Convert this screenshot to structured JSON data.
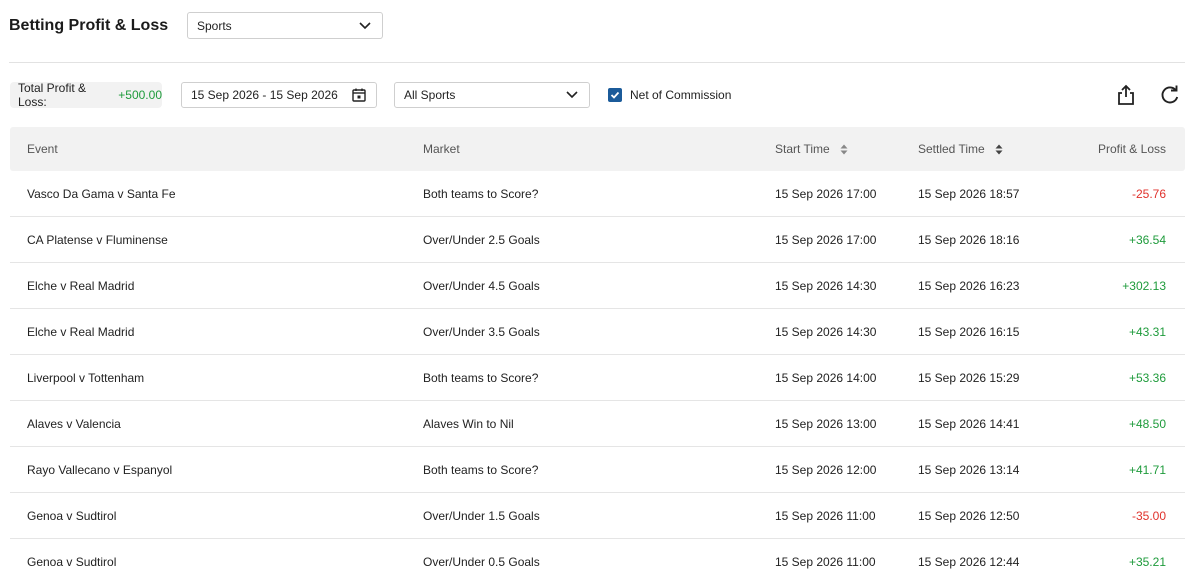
{
  "header": {
    "title": "Betting Profit & Loss",
    "product_select": "Sports"
  },
  "filters": {
    "total_label": "Total Profit & Loss:",
    "total_value": "+500.00",
    "date_range": "15 Sep 2026 - 15 Sep 2026",
    "sport_select": "All Sports",
    "net_of_commission_label": "Net of Commission",
    "net_of_commission_checked": true
  },
  "icons": {
    "calendar": "calendar-icon",
    "export": "share-export-icon",
    "refresh": "refresh-icon",
    "sort": "sort-icon",
    "chevron": "chevron-down-icon",
    "check": "check-icon"
  },
  "colors": {
    "profit": "#1e9b3b",
    "loss": "#e0322c",
    "checkbox": "#1b5b9a",
    "header_bg": "#f2f2f2"
  },
  "table": {
    "columns": {
      "event": "Event",
      "market": "Market",
      "start_time": "Start Time",
      "settled_time": "Settled Time",
      "profit_loss": "Profit & Loss"
    },
    "rows": [
      {
        "event": "Vasco Da Gama v Santa Fe",
        "market": "Both teams to Score?",
        "start": "15 Sep 2026 17:00",
        "settled": "15 Sep 2026 18:57",
        "pl": "-25.76",
        "sign": "neg"
      },
      {
        "event": "CA Platense v Fluminense",
        "market": "Over/Under 2.5 Goals",
        "start": "15 Sep 2026 17:00",
        "settled": "15 Sep 2026 18:16",
        "pl": "+36.54",
        "sign": "pos"
      },
      {
        "event": "Elche v Real Madrid",
        "market": "Over/Under 4.5 Goals",
        "start": "15 Sep 2026 14:30",
        "settled": "15 Sep 2026 16:23",
        "pl": "+302.13",
        "sign": "pos"
      },
      {
        "event": "Elche v Real Madrid",
        "market": "Over/Under 3.5 Goals",
        "start": "15 Sep 2026 14:30",
        "settled": "15 Sep 2026 16:15",
        "pl": "+43.31",
        "sign": "pos"
      },
      {
        "event": "Liverpool v Tottenham",
        "market": "Both teams to Score?",
        "start": "15 Sep 2026 14:00",
        "settled": "15 Sep 2026 15:29",
        "pl": "+53.36",
        "sign": "pos"
      },
      {
        "event": "Alaves v Valencia",
        "market": "Alaves Win to Nil",
        "start": "15 Sep 2026 13:00",
        "settled": "15 Sep 2026 14:41",
        "pl": "+48.50",
        "sign": "pos"
      },
      {
        "event": "Rayo Vallecano v Espanyol",
        "market": "Both teams to Score?",
        "start": "15 Sep 2026 12:00",
        "settled": "15 Sep 2026 13:14",
        "pl": "+41.71",
        "sign": "pos"
      },
      {
        "event": "Genoa v Sudtirol",
        "market": "Over/Under 1.5 Goals",
        "start": "15 Sep 2026 11:00",
        "settled": "15 Sep 2026 12:50",
        "pl": "-35.00",
        "sign": "neg"
      },
      {
        "event": "Genoa v Sudtirol",
        "market": "Over/Under 0.5 Goals",
        "start": "15 Sep 2026 11:00",
        "settled": "15 Sep 2026 12:44",
        "pl": "+35.21",
        "sign": "pos"
      }
    ]
  }
}
